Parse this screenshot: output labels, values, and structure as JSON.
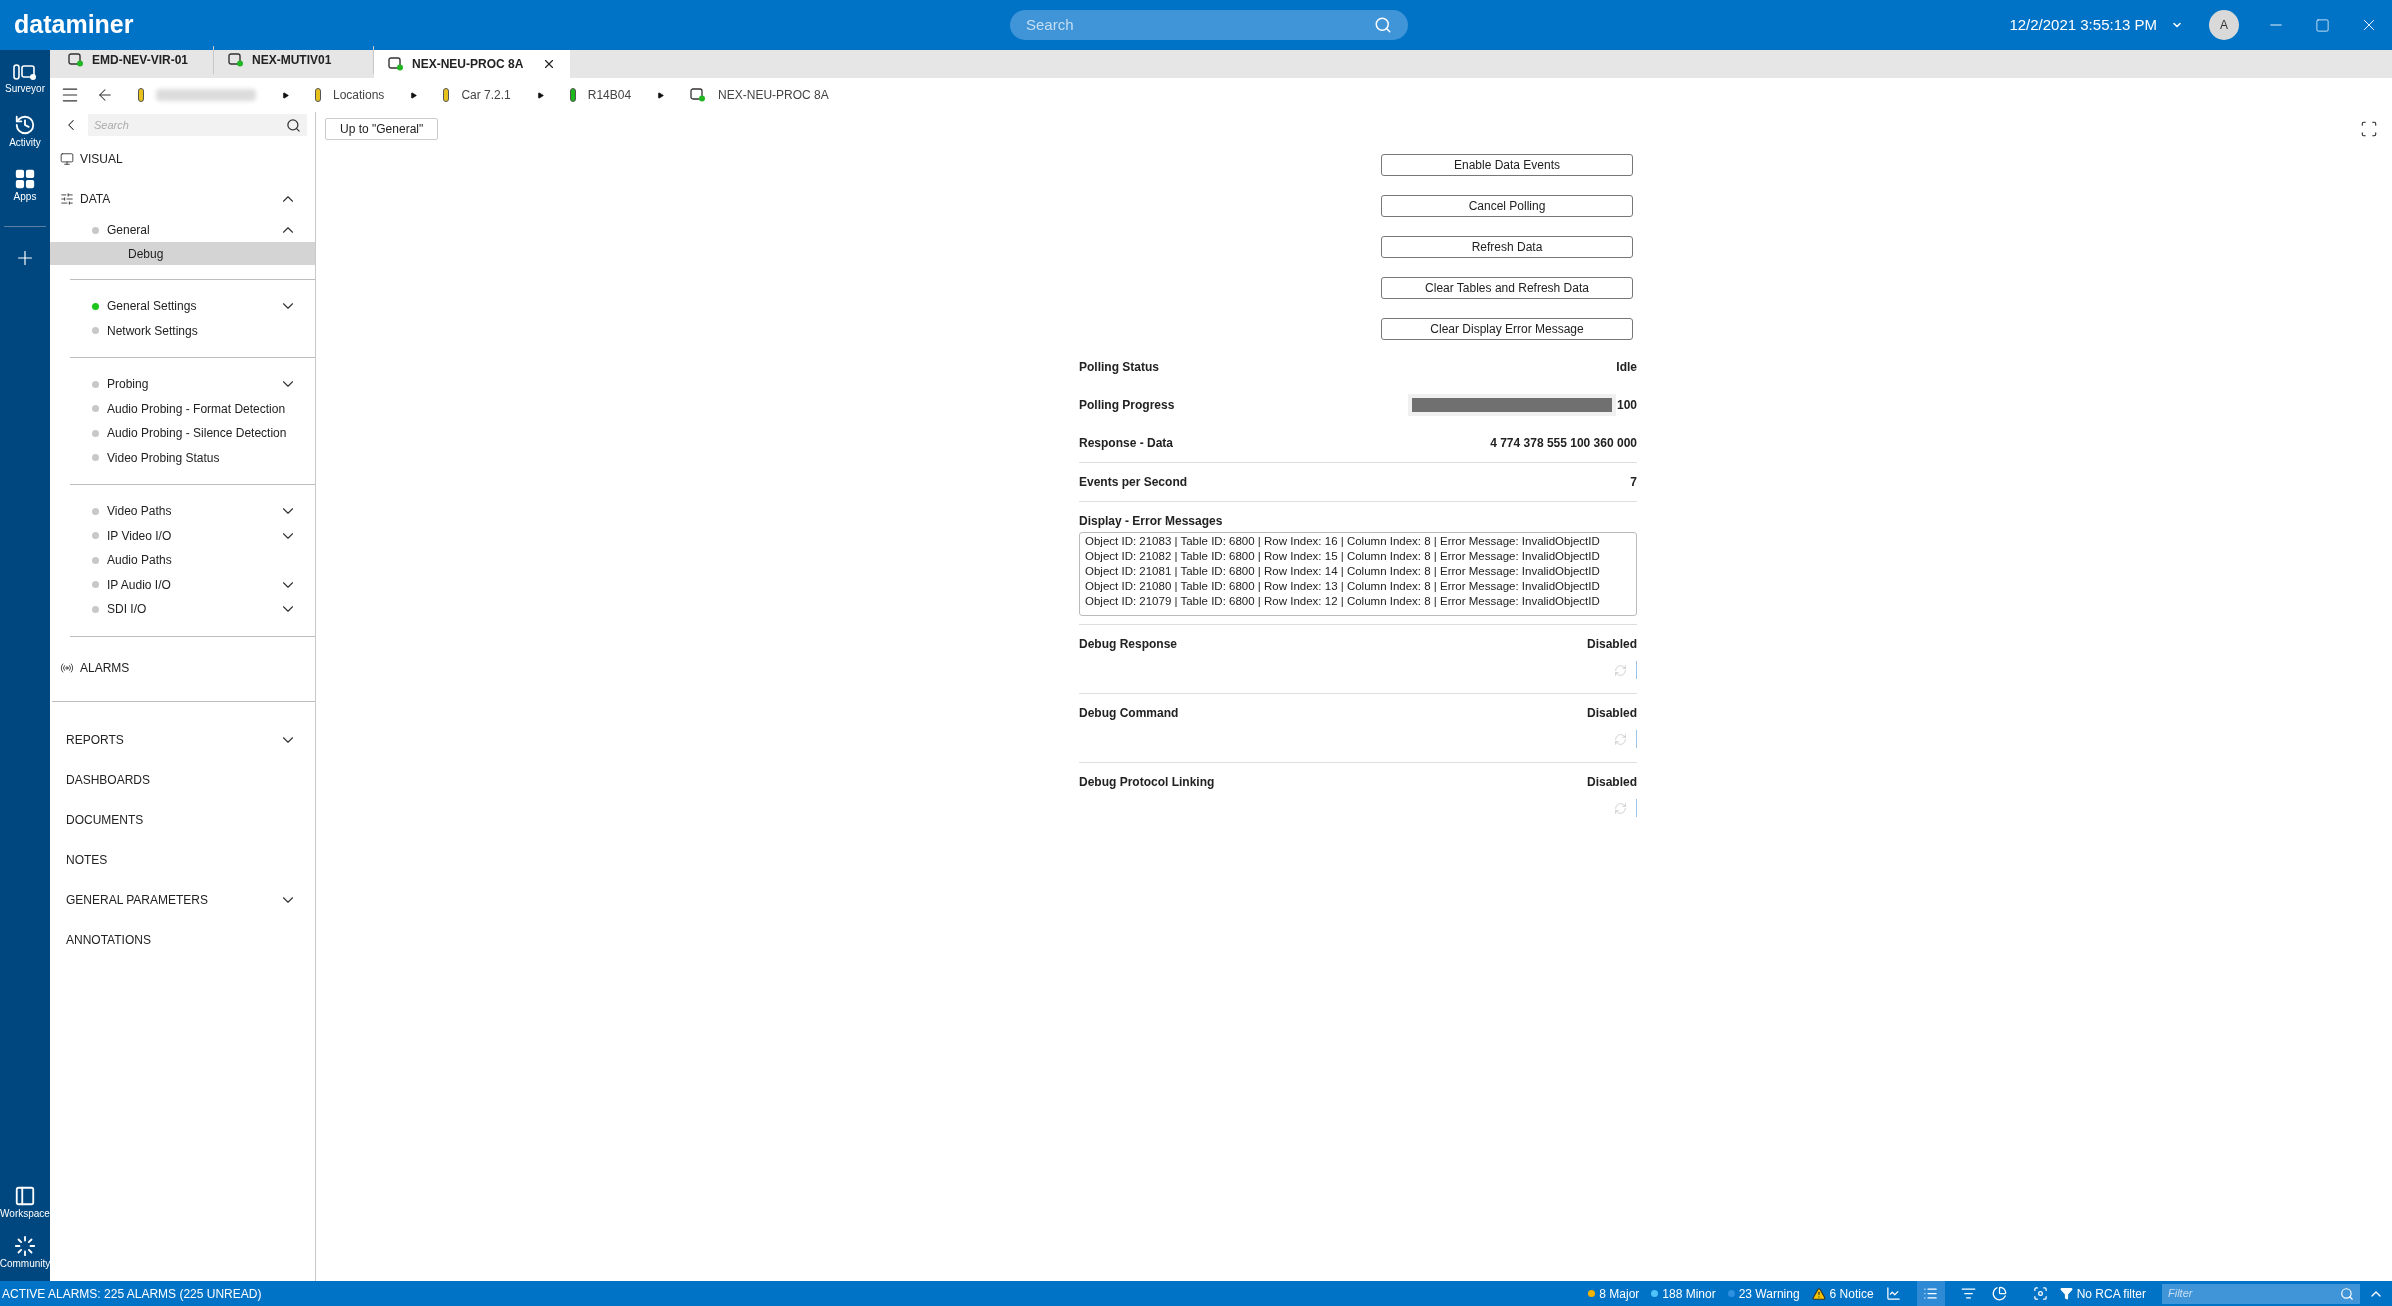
{
  "header": {
    "logo": "dataminer",
    "search_placeholder": "Search",
    "datetime": "12/2/2021 3:55:13 PM",
    "avatar": "A"
  },
  "rail_top": [
    {
      "kind": "surveyor",
      "label": "Surveyor"
    },
    {
      "kind": "activity",
      "label": "Activity"
    },
    {
      "kind": "apps",
      "label": "Apps"
    }
  ],
  "rail_bottom": [
    {
      "kind": "workspace",
      "label": "Workspace"
    },
    {
      "kind": "community",
      "label": "Community"
    }
  ],
  "tabs": [
    {
      "label": "EMD-NEV-VIR-01",
      "selected": false
    },
    {
      "label": "NEX-MUTIV01",
      "selected": false
    },
    {
      "label": "NEX-NEU-PROC 8A",
      "selected": true
    }
  ],
  "breadcrumb": [
    {
      "kind": "view",
      "color": "#e8c21c",
      "redacted": true
    },
    {
      "kind": "view",
      "color": "#e8c21c",
      "label": "Locations"
    },
    {
      "kind": "view",
      "color": "#e8c21c",
      "label": "Car 7.2.1"
    },
    {
      "kind": "view",
      "color": "#1cb81c",
      "label": "R14B04"
    },
    {
      "kind": "element",
      "label": "NEX-NEU-PROC 8A"
    }
  ],
  "sidebar": {
    "search_placeholder": "Search",
    "visual": "VISUAL",
    "data": {
      "label": "DATA",
      "expanded": true
    },
    "page": {
      "label": "General",
      "expanded": true,
      "color": "#c8c8c8",
      "children": [
        {
          "label": "Debug",
          "selected": true
        }
      ]
    },
    "page_groups": [
      [
        {
          "label": "General Settings",
          "color": "#1cc41c",
          "expandable": true
        },
        {
          "label": "Network Settings",
          "color": "#c8c8c8",
          "expandable": false
        }
      ],
      [
        {
          "label": "Probing",
          "color": "#c8c8c8",
          "expandable": true
        },
        {
          "label": "Audio Probing - Format Detection",
          "color": "#c8c8c8",
          "expandable": false
        },
        {
          "label": "Audio Probing - Silence Detection",
          "color": "#c8c8c8",
          "expandable": false
        },
        {
          "label": "Video Probing Status",
          "color": "#c8c8c8",
          "expandable": false
        }
      ],
      [
        {
          "label": "Video Paths",
          "color": "#c8c8c8",
          "expandable": true
        },
        {
          "label": "IP Video I/O",
          "color": "#c8c8c8",
          "expandable": true
        },
        {
          "label": "Audio Paths",
          "color": "#c8c8c8",
          "expandable": false
        },
        {
          "label": "IP Audio I/O",
          "color": "#c8c8c8",
          "expandable": true
        },
        {
          "label": "SDI I/O",
          "color": "#c8c8c8",
          "expandable": true
        }
      ]
    ],
    "alarms": "ALARMS",
    "modules": [
      {
        "label": "REPORTS",
        "expandable": true
      },
      {
        "label": "DASHBOARDS",
        "expandable": false
      },
      {
        "label": "DOCUMENTS",
        "expandable": false
      },
      {
        "label": "NOTES",
        "expandable": false
      },
      {
        "label": "GENERAL PARAMETERS",
        "expandable": true
      },
      {
        "label": "ANNOTATIONS",
        "expandable": false
      }
    ]
  },
  "up_button": "Up to \"General\"",
  "buttons": [
    "Enable Data Events",
    "Cancel Polling",
    "Refresh Data",
    "Clear Tables and Refresh Data",
    "Clear Display Error Message"
  ],
  "params": [
    {
      "kind": "text",
      "label": "Polling Status",
      "value": "Idle"
    },
    {
      "kind": "progress",
      "label": "Polling Progress",
      "level": 1,
      "reading": "100"
    },
    {
      "kind": "text",
      "label": "Response - Data",
      "value": "4 774 378 555 100 360 000"
    },
    {
      "kind": "text",
      "label": "Events per Second",
      "value": "7"
    },
    {
      "kind": "log",
      "label": "Display - Error Messages",
      "lines": [
        "Object ID: 21083 | Table ID: 6800 | Row Index: 16 | Column Index: 8 | Error Message: InvalidObjectID",
        "Object ID: 21082 | Table ID: 6800 | Row Index: 15 | Column Index: 8 | Error Message: InvalidObjectID",
        "Object ID: 21081 | Table ID: 6800 | Row Index: 14 | Column Index: 8 | Error Message: InvalidObjectID",
        "Object ID: 21080 | Table ID: 6800 | Row Index: 13 | Column Index: 8 | Error Message: InvalidObjectID",
        "Object ID: 21079 | Table ID: 6800 | Row Index: 12 | Column Index: 8 | Error Message: InvalidObjectID"
      ]
    },
    {
      "kind": "toggle",
      "label": "Debug Response",
      "value": "Disabled"
    },
    {
      "kind": "toggle",
      "label": "Debug Command",
      "value": "Disabled"
    },
    {
      "kind": "toggle",
      "label": "Debug Protocol Linking",
      "value": "Disabled"
    }
  ],
  "status_bar": {
    "active_alarms": "ACTIVE ALARMS: 225 ALARMS (225 UNREAD)",
    "counts": [
      {
        "kind": "dot",
        "label": "8 Major",
        "color": "#f5b400"
      },
      {
        "kind": "dot",
        "label": "188 Minor",
        "color": "#4fc3f7"
      },
      {
        "kind": "dot",
        "label": "23 Warning",
        "color": "#2f8fe0"
      },
      {
        "kind": "triangle",
        "label": "6 Notice",
        "color": "#f5c400"
      }
    ],
    "rca_filter": "No RCA filter",
    "filter_placeholder": "Filter"
  }
}
